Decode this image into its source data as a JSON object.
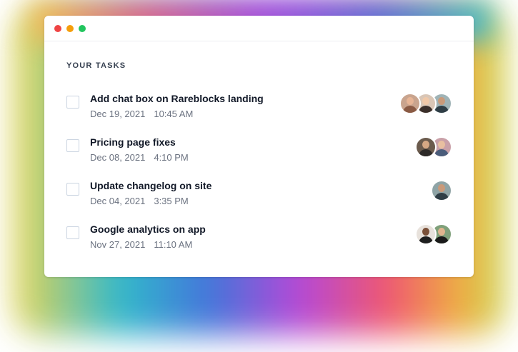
{
  "window": {
    "heading": "YOUR TASKS"
  },
  "tasks": [
    {
      "title": "Add chat box on Rareblocks landing",
      "date": "Dec 19, 2021",
      "time": "10:45 AM",
      "avatars": [
        {
          "bg": "#c9a48e",
          "skin": "#e7b596",
          "shirt": "#8a5a44"
        },
        {
          "bg": "#d9c6b6",
          "skin": "#f0c8a8",
          "shirt": "#3b2f2a"
        },
        {
          "bg": "#9fb3b6",
          "skin": "#c99a7a",
          "shirt": "#2f3e46"
        }
      ]
    },
    {
      "title": "Pricing page fixes",
      "date": "Dec 08, 2021",
      "time": "4:10 PM",
      "avatars": [
        {
          "bg": "#6b5b4d",
          "skin": "#d6a884",
          "shirt": "#2d2a28"
        },
        {
          "bg": "#c9a0a8",
          "skin": "#e8bfa0",
          "shirt": "#4a5c7a"
        }
      ]
    },
    {
      "title": "Update changelog on site",
      "date": "Dec 04, 2021",
      "time": "3:35 PM",
      "avatars": [
        {
          "bg": "#8fa4a6",
          "skin": "#c99a7a",
          "shirt": "#2f3e46"
        }
      ]
    },
    {
      "title": "Google analytics on app",
      "date": "Nov 27, 2021",
      "time": "11:10 AM",
      "avatars": [
        {
          "bg": "#e8e2dc",
          "skin": "#7a5038",
          "shirt": "#1f1f1f"
        },
        {
          "bg": "#7fa07a",
          "skin": "#e0b48e",
          "shirt": "#1a1a1a"
        }
      ]
    }
  ]
}
